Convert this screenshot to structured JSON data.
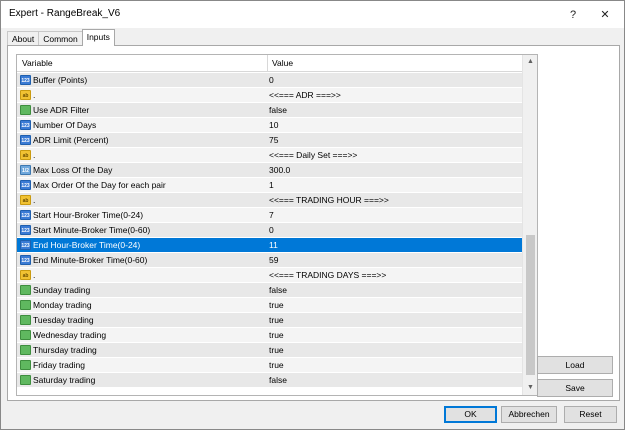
{
  "window": {
    "title": "Expert - RangeBreak_V6",
    "help_label": "?",
    "close_label": "✕"
  },
  "tabs": [
    {
      "label": "About"
    },
    {
      "label": "Common"
    },
    {
      "label": "Inputs"
    }
  ],
  "grid": {
    "columns": {
      "variable": "Variable",
      "value": "Value"
    },
    "rows": [
      {
        "icon": "int-icon",
        "icon_text": "123",
        "variable": "Buffer (Points)",
        "value": "0"
      },
      {
        "icon": "string-icon",
        "icon_text": "ab",
        "variable": ".",
        "value": "<<=== ADR ===>>"
      },
      {
        "icon": "bool-icon",
        "icon_text": "",
        "variable": "Use ADR Filter",
        "value": "false"
      },
      {
        "icon": "int-icon",
        "icon_text": "123",
        "variable": "Number Of Days",
        "value": "10"
      },
      {
        "icon": "int-icon",
        "icon_text": "123",
        "variable": "ADR Limit (Percent)",
        "value": "75"
      },
      {
        "icon": "string-icon",
        "icon_text": "ab",
        "variable": ".",
        "value": "<<=== Daily Set ===>>"
      },
      {
        "icon": "double-icon",
        "icon_text": "1/2",
        "variable": "Max Loss Of the Day",
        "value": "300.0"
      },
      {
        "icon": "int-icon",
        "icon_text": "123",
        "variable": "Max Order Of the Day for each pair",
        "value": "1"
      },
      {
        "icon": "string-icon",
        "icon_text": "ab",
        "variable": ".",
        "value": "<<=== TRADING HOUR ===>>"
      },
      {
        "icon": "int-icon",
        "icon_text": "123",
        "variable": "Start Hour-Broker Time(0-24)",
        "value": "7"
      },
      {
        "icon": "int-icon",
        "icon_text": "123",
        "variable": "Start Minute-Broker Time(0-60)",
        "value": "0"
      },
      {
        "icon": "int-icon",
        "icon_text": "123",
        "variable": "End Hour-Broker Time(0-24)",
        "value": "11",
        "selected": true
      },
      {
        "icon": "int-icon",
        "icon_text": "123",
        "variable": "End Minute-Broker Time(0-60)",
        "value": "59"
      },
      {
        "icon": "string-icon",
        "icon_text": "ab",
        "variable": ".",
        "value": "<<=== TRADING DAYS ===>>"
      },
      {
        "icon": "bool-icon",
        "icon_text": "",
        "variable": "Sunday trading",
        "value": "false"
      },
      {
        "icon": "bool-icon",
        "icon_text": "",
        "variable": "Monday trading",
        "value": "true"
      },
      {
        "icon": "bool-icon",
        "icon_text": "",
        "variable": "Tuesday trading",
        "value": "true"
      },
      {
        "icon": "bool-icon",
        "icon_text": "",
        "variable": "Wednesday trading",
        "value": "true"
      },
      {
        "icon": "bool-icon",
        "icon_text": "",
        "variable": "Thursday trading",
        "value": "true"
      },
      {
        "icon": "bool-icon",
        "icon_text": "",
        "variable": "Friday trading",
        "value": "true"
      },
      {
        "icon": "bool-icon",
        "icon_text": "",
        "variable": "Saturday trading",
        "value": "false"
      }
    ]
  },
  "side_buttons": {
    "load": "Load",
    "save": "Save"
  },
  "bottom_buttons": {
    "ok": "OK",
    "cancel": "Abbrechen",
    "reset": "Reset"
  },
  "colors": {
    "selection": "#0078d7",
    "accent": "#0078d7"
  }
}
